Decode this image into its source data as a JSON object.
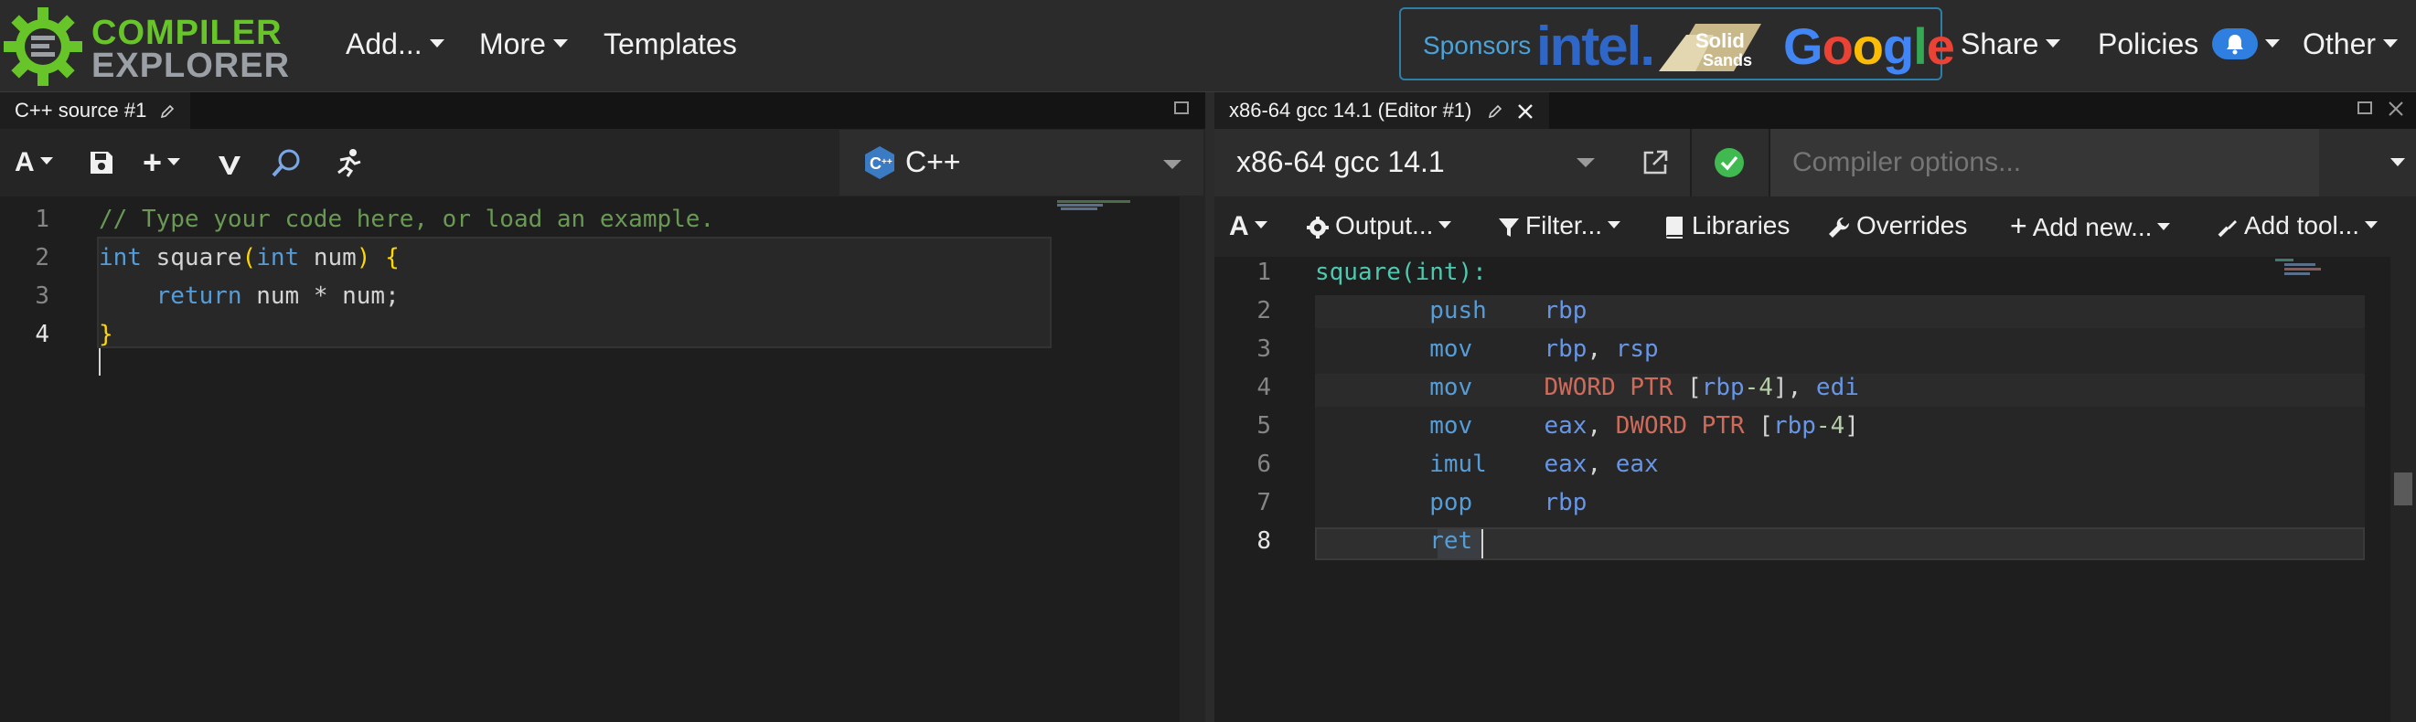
{
  "nav": {
    "logo_line1": "COMPILER",
    "logo_line2": "EXPLORER",
    "add_label": "Add...",
    "more_label": "More",
    "templates_label": "Templates",
    "sponsors_label": "Sponsors",
    "sponsor_intel": "intel.",
    "sponsor_solid_1": "Solid",
    "sponsor_solid_2": "Sands",
    "sponsor_google": [
      "G",
      "o",
      "o",
      "g",
      "l",
      "e"
    ],
    "share_label": "Share",
    "policies_label": "Policies",
    "other_label": "Other"
  },
  "colors": {
    "brand_green": "#67c52a",
    "google_colors": [
      "#4285f4",
      "#ea4335",
      "#fbbc05",
      "#4285f4",
      "#34a853",
      "#ea4335"
    ],
    "status_ok": "#3fb950"
  },
  "source_pane": {
    "tab_title": "C++ source #1",
    "font_button": "A",
    "language": "C++",
    "lines": [
      {
        "num": "1",
        "tokens": [
          {
            "t": "// Type your code here, or load an example.",
            "c": "c-com"
          }
        ]
      },
      {
        "num": "2",
        "tokens": [
          {
            "t": "int",
            "c": "c-kw"
          },
          {
            "t": " square",
            "c": "c-plain"
          },
          {
            "t": "(",
            "c": "c-br"
          },
          {
            "t": "int",
            "c": "c-kw"
          },
          {
            "t": " num",
            "c": "c-plain"
          },
          {
            "t": ")",
            "c": "c-br"
          },
          {
            "t": " ",
            "c": "c-plain"
          },
          {
            "t": "{",
            "c": "c-br"
          }
        ]
      },
      {
        "num": "3",
        "tokens": [
          {
            "t": "    return",
            "c": "c-kw"
          },
          {
            "t": " num * num;",
            "c": "c-plain"
          }
        ]
      },
      {
        "num": "4",
        "tokens": [
          {
            "t": "}",
            "c": "c-br"
          }
        ]
      }
    ]
  },
  "compiler_pane": {
    "tab_title": "x86-64 gcc 14.1 (Editor #1)",
    "compiler_name": "x86-64 gcc 14.1",
    "options_placeholder": "Compiler options...",
    "font_button": "A",
    "output_label": "Output...",
    "filter_label": "Filter...",
    "libraries_label": "Libraries",
    "overrides_label": "Overrides",
    "add_new_label": "Add new...",
    "add_tool_label": "Add tool...",
    "lines": [
      {
        "num": "1",
        "tokens": [
          {
            "t": "square(int):",
            "c": "c-lbl"
          }
        ]
      },
      {
        "num": "2",
        "tokens": [
          {
            "t": "        push",
            "c": "c-ins"
          },
          {
            "t": "    ",
            "c": "c-plain"
          },
          {
            "t": "rbp",
            "c": "c-reg"
          }
        ]
      },
      {
        "num": "3",
        "tokens": [
          {
            "t": "        mov",
            "c": "c-ins"
          },
          {
            "t": "     ",
            "c": "c-plain"
          },
          {
            "t": "rbp",
            "c": "c-reg"
          },
          {
            "t": ", ",
            "c": "c-plain"
          },
          {
            "t": "rsp",
            "c": "c-reg"
          }
        ]
      },
      {
        "num": "4",
        "tokens": [
          {
            "t": "        mov",
            "c": "c-ins"
          },
          {
            "t": "     ",
            "c": "c-plain"
          },
          {
            "t": "DWORD PTR",
            "c": "c-ptr"
          },
          {
            "t": " [",
            "c": "c-plain"
          },
          {
            "t": "rbp",
            "c": "c-reg"
          },
          {
            "t": "-4",
            "c": "c-num"
          },
          {
            "t": "], ",
            "c": "c-plain"
          },
          {
            "t": "edi",
            "c": "c-reg"
          }
        ]
      },
      {
        "num": "5",
        "tokens": [
          {
            "t": "        mov",
            "c": "c-ins"
          },
          {
            "t": "     ",
            "c": "c-plain"
          },
          {
            "t": "eax",
            "c": "c-reg"
          },
          {
            "t": ", ",
            "c": "c-plain"
          },
          {
            "t": "DWORD PTR",
            "c": "c-ptr"
          },
          {
            "t": " [",
            "c": "c-plain"
          },
          {
            "t": "rbp",
            "c": "c-reg"
          },
          {
            "t": "-4",
            "c": "c-num"
          },
          {
            "t": "]",
            "c": "c-plain"
          }
        ]
      },
      {
        "num": "6",
        "tokens": [
          {
            "t": "        imul",
            "c": "c-ins"
          },
          {
            "t": "    ",
            "c": "c-plain"
          },
          {
            "t": "eax",
            "c": "c-reg"
          },
          {
            "t": ", ",
            "c": "c-plain"
          },
          {
            "t": "eax",
            "c": "c-reg"
          }
        ]
      },
      {
        "num": "7",
        "tokens": [
          {
            "t": "        pop",
            "c": "c-ins"
          },
          {
            "t": "     ",
            "c": "c-plain"
          },
          {
            "t": "rbp",
            "c": "c-reg"
          }
        ]
      },
      {
        "num": "8",
        "tokens": [
          {
            "t": "        ret",
            "c": "c-ins"
          }
        ]
      }
    ]
  }
}
